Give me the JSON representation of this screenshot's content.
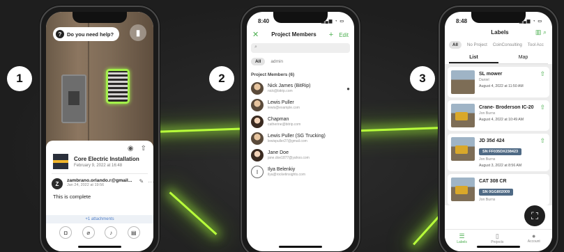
{
  "steps": [
    "1",
    "2",
    "3"
  ],
  "phone1": {
    "help_label": "Do you need help?",
    "installation_title": "Core Electric Installation",
    "installation_date": "February 9, 2022 at 16:48",
    "comment": {
      "author": "zambrano.orlando.r@gmail...",
      "author_initial": "Z",
      "time": "Jan 24, 2022 at 19:56",
      "text": "This is complete"
    },
    "attachments_label": "+1 attachments"
  },
  "phone2": {
    "time": "8:40",
    "title": "Project Members",
    "edit_label": "Edit",
    "search_placeholder": "",
    "filters": [
      "All",
      "admin"
    ],
    "section_label": "Project Members (6)",
    "members": [
      {
        "name": "Nick James (BitRip)",
        "email": "nick@bitrip.com",
        "style": "photo"
      },
      {
        "name": "Lewis Puller",
        "email": "lewis@example.com",
        "style": "photo"
      },
      {
        "name": " Chapman",
        "email": "catherine@bitrip.com",
        "style": "photo-f"
      },
      {
        "name": "Lewis Puller (SG Trucking)",
        "email": "lewispuller27@gmail.com",
        "style": "photo"
      },
      {
        "name": "Jane Doe",
        "email": "jane.doe1877@yahoo.com",
        "style": "photo-f"
      },
      {
        "name": "Ilya Belenkiy",
        "email": "ilya@rocketinsights.com",
        "style": "initial",
        "initial": "I"
      }
    ]
  },
  "phone3": {
    "time": "8:48",
    "title": "Labels",
    "project_filters": [
      "All",
      "No Project",
      "CoinConsulting",
      "Tool Acc"
    ],
    "segments": [
      "List",
      "Map"
    ],
    "labels": [
      {
        "title": "SL mower",
        "owner": "Daniel",
        "date": "August 4, 2022 at 11:50 AM",
        "sn": ""
      },
      {
        "title": "Crane- Broderson IC-20",
        "owner": "Jon Burns",
        "date": "August 4, 2022 at 10:49 AM",
        "sn": ""
      },
      {
        "title": "JD 35d 424",
        "owner": "Jon Burns",
        "date": "August 3, 2022 at 8:56 AM",
        "sn": "SN FF035DX238423"
      },
      {
        "title": "CAT 308 CR",
        "owner": "Jon Burns",
        "date": "",
        "sn": "SN 0GG802009"
      }
    ],
    "tabbar": [
      "Labels",
      "Projects",
      "Account"
    ]
  },
  "colors": {
    "accent": "#4caf50",
    "beam": "#b8ff3a",
    "background": "#242424"
  }
}
